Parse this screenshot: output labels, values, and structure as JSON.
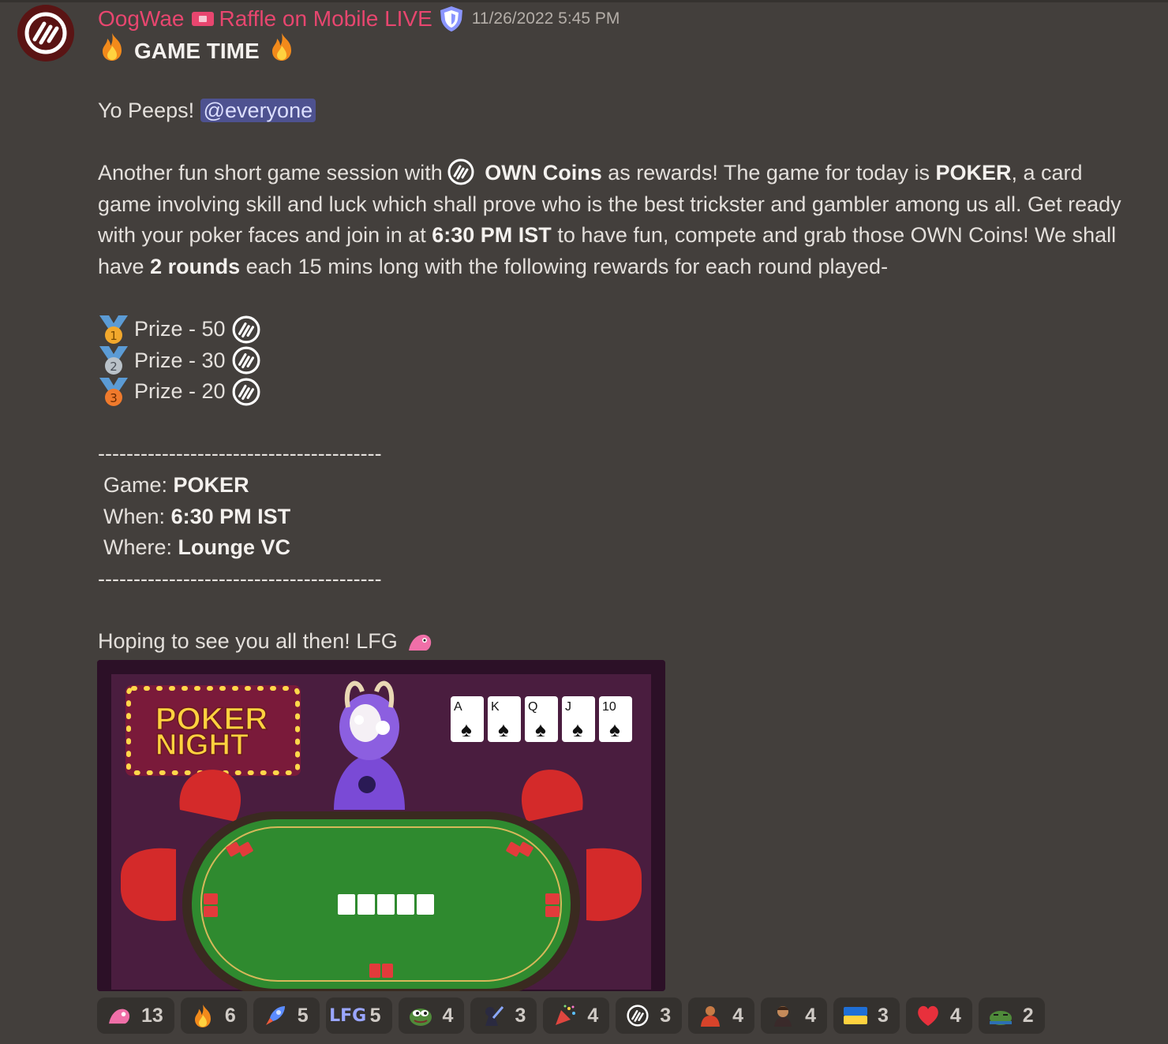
{
  "message": {
    "username": "OogWae",
    "role": "Raffle on Mobile LIVE",
    "timestamp": "11/26/2022 5:45 PM",
    "title": "GAME TIME",
    "greeting": "Yo Peeps!",
    "mention": "@everyone",
    "para_1": "Another fun short game session with",
    "para_coins": "OWN Coins",
    "para_2": "as rewards! The game for today is",
    "para_poker": "POKER",
    "para_3": ", a card game involving skill and luck which shall prove who is the best trickster and gambler among us all. Get ready with your poker faces and join in at",
    "para_time": "6:30 PM IST",
    "para_4": "to have fun, compete and grab those OWN Coins! We shall have",
    "para_rounds": "2 rounds",
    "para_5": "each 15 mins long with the following rewards for each round played-",
    "prizes": [
      {
        "label": "Prize - 50",
        "medal": "1"
      },
      {
        "label": "Prize - 30",
        "medal": "2"
      },
      {
        "label": "Prize - 20",
        "medal": "3"
      }
    ],
    "dashes": "----------------------------------------",
    "info": {
      "game_label": "Game:",
      "game_value": "POKER",
      "when_label": "When:",
      "when_value": "6:30 PM IST",
      "where_label": "Where:",
      "where_value": "Lounge VC"
    },
    "closing": "Hoping to see you all then! LFG"
  },
  "image": {
    "title_line1": "POKER",
    "title_line2": "NIGHT",
    "cards": [
      "A",
      "K",
      "Q",
      "J",
      "10"
    ]
  },
  "reactions": [
    {
      "icon": "pink-blob-icon",
      "count": "13"
    },
    {
      "icon": "fire-icon",
      "count": "6"
    },
    {
      "icon": "rocket-icon",
      "count": "5"
    },
    {
      "icon": "lfg-icon",
      "label": "LFG",
      "count": "5"
    },
    {
      "icon": "pepe-icon",
      "count": "4"
    },
    {
      "icon": "ninja-icon",
      "count": "3"
    },
    {
      "icon": "party-popper-icon",
      "count": "4"
    },
    {
      "icon": "own-coin-icon",
      "count": "3"
    },
    {
      "icon": "monk-icon",
      "count": "4"
    },
    {
      "icon": "man-face-icon",
      "count": "4"
    },
    {
      "icon": "ukraine-flag-icon",
      "count": "3"
    },
    {
      "icon": "heart-icon",
      "count": "4"
    },
    {
      "icon": "pepe-sleep-icon",
      "count": "2"
    }
  ],
  "colors": {
    "background": "#433f3c",
    "username": "#e8466f",
    "mention_bg": "#4e5290",
    "reaction_bg": "#34312e"
  }
}
